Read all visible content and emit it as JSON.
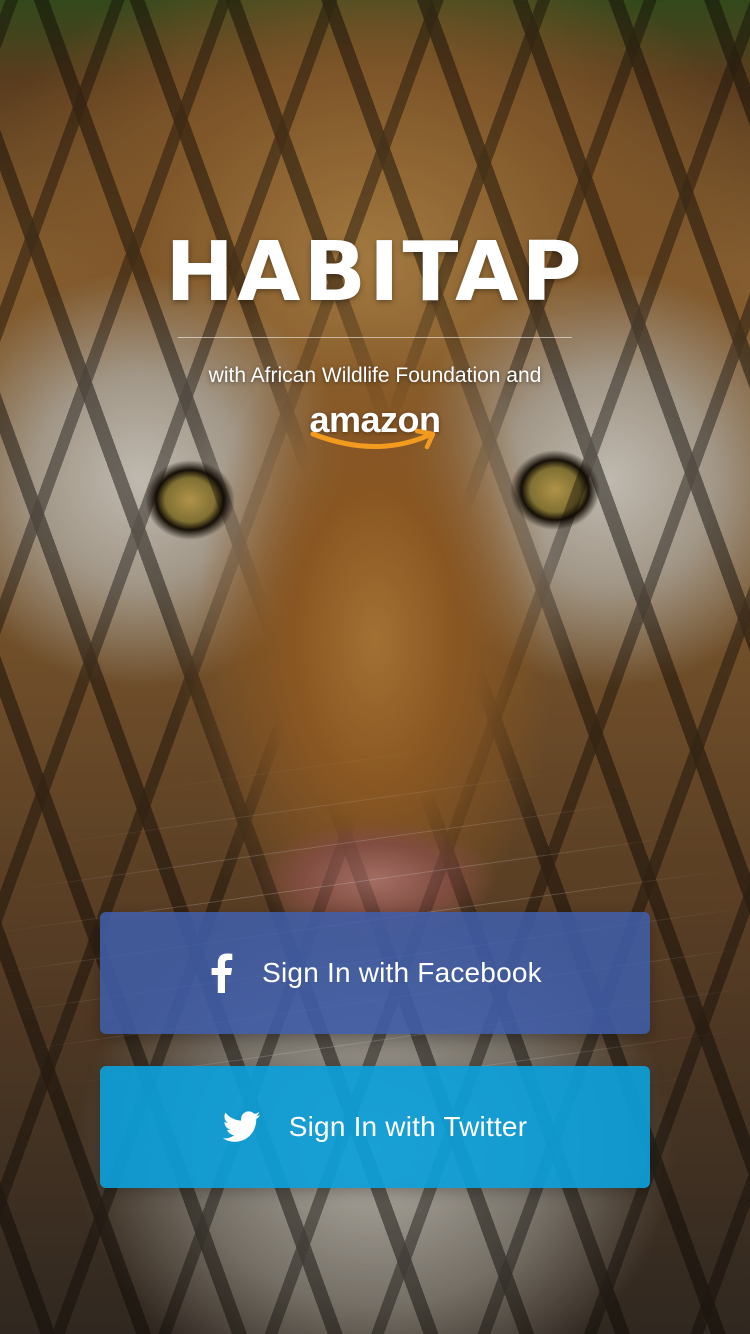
{
  "app": {
    "title": "HABITAP",
    "partner_line": "with African Wildlife Foundation and",
    "partner_logo_text": "amazon"
  },
  "actions": {
    "facebook": {
      "label": "Sign In with Facebook",
      "icon": "facebook-icon",
      "color": "#405DA8"
    },
    "twitter": {
      "label": "Sign In with Twitter",
      "icon": "twitter-bird-icon",
      "color": "#0C9ED8"
    }
  },
  "background": {
    "subject": "tiger-face-photo"
  },
  "colors": {
    "text": "#FFFFFF",
    "amazon_smile": "#F29B1F"
  }
}
